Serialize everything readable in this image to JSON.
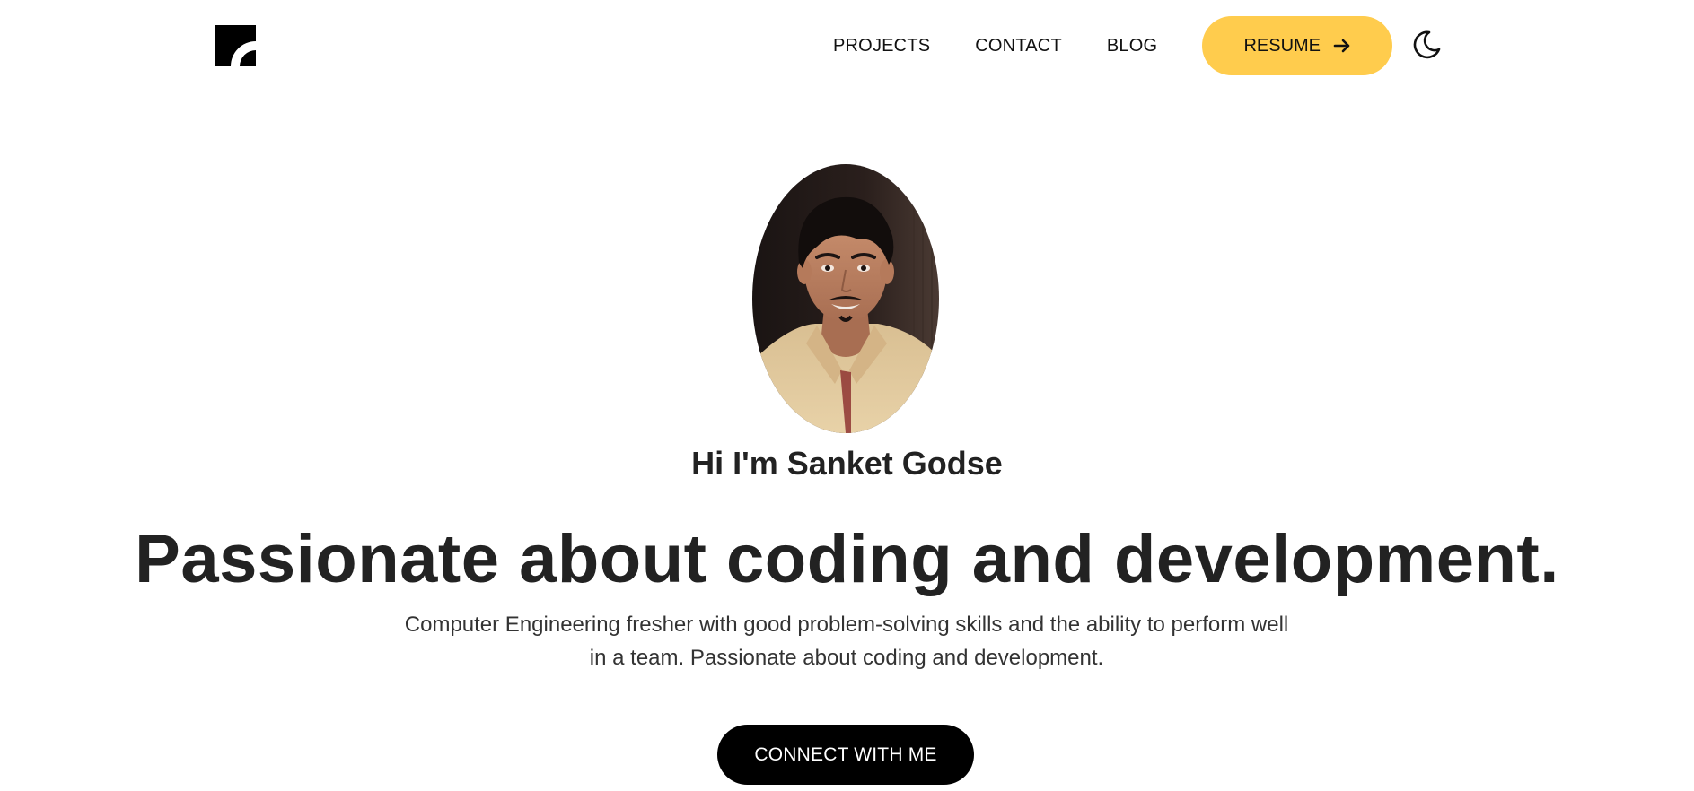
{
  "header": {
    "logo_icon": "logo-icon",
    "nav": {
      "projects": "PROJECTS",
      "contact": "CONTACT",
      "blog": "BLOG"
    },
    "resume_label": "RESUME",
    "resume_icon": "arrow-right-icon",
    "theme_icon": "moon-icon"
  },
  "hero": {
    "avatar_icon": "profile-photo",
    "greeting": "Hi I'm Sanket Godse",
    "headline": "Passionate about coding and development.",
    "description": "Computer Engineering fresher with good problem-solving skills and the ability to perform well in a team. Passionate about coding and development.",
    "cta_label": "CONNECT WITH ME"
  },
  "colors": {
    "accent": "#ffcc4d",
    "text": "#222222",
    "cta_bg": "#000000",
    "background": "#ffffff"
  }
}
